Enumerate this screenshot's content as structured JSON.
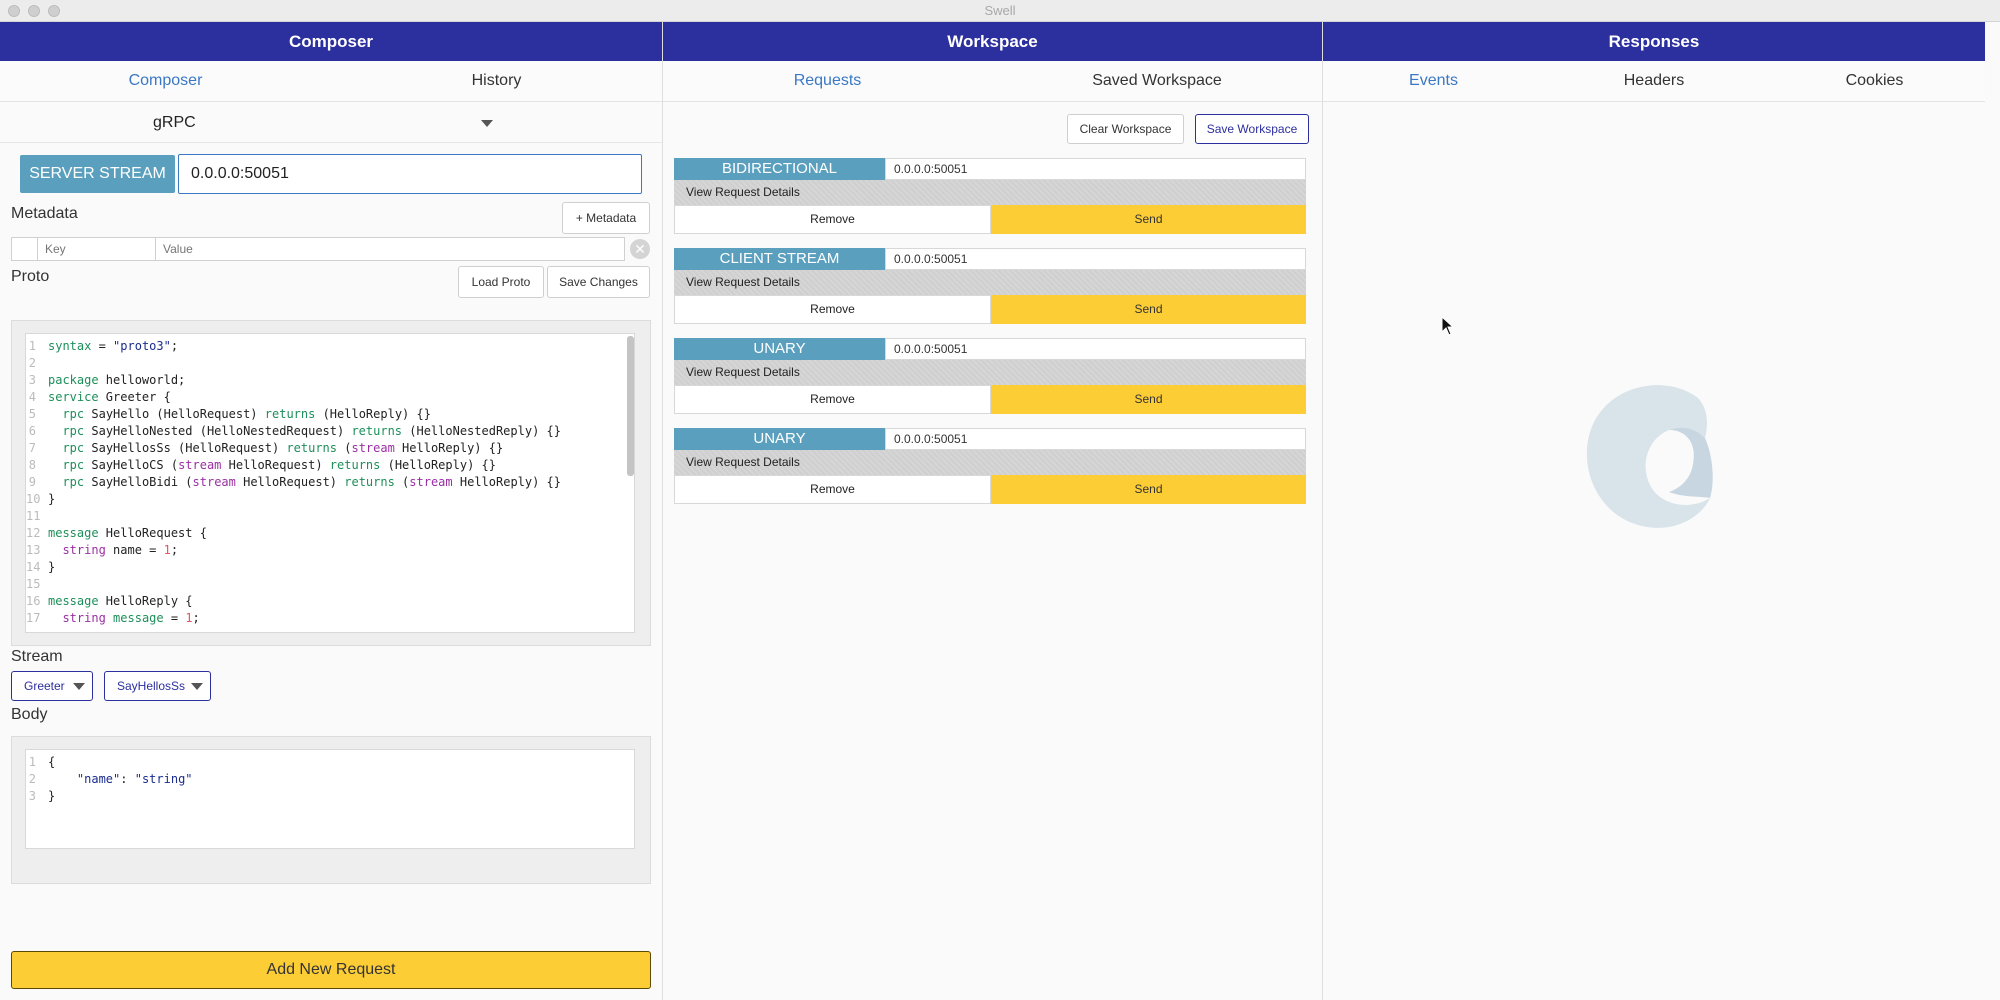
{
  "window": {
    "title": "Swell"
  },
  "composer": {
    "header": "Composer",
    "tabs": [
      {
        "label": "Composer"
      },
      {
        "label": "History"
      }
    ],
    "protocol": "gRPC",
    "method_label": "SERVER STREAM",
    "url_value": "0.0.0.0:50051",
    "metadata_label": "Metadata",
    "add_metadata_label": "+ Metadata",
    "key_placeholder": "Key",
    "value_placeholder": "Value",
    "proto_label": "Proto",
    "load_proto_label": "Load Proto",
    "save_changes_label": "Save Changes",
    "stream_label": "Stream",
    "service_select": "Greeter",
    "method_select": "SayHellosSs",
    "body_label": "Body",
    "add_request_label": "Add New Request"
  },
  "workspace": {
    "header": "Workspace",
    "tabs": [
      {
        "label": "Requests"
      },
      {
        "label": "Saved Workspace"
      }
    ],
    "clear_label": "Clear Workspace",
    "save_label": "Save Workspace",
    "requests": [
      {
        "type": "BIDIRECTIONAL",
        "url": "0.0.0.0:50051",
        "details": "View Request Details",
        "remove": "Remove",
        "send": "Send"
      },
      {
        "type": "CLIENT STREAM",
        "url": "0.0.0.0:50051",
        "details": "View Request Details",
        "remove": "Remove",
        "send": "Send"
      },
      {
        "type": "UNARY",
        "url": "0.0.0.0:50051",
        "details": "View Request Details",
        "remove": "Remove",
        "send": "Send"
      },
      {
        "type": "UNARY",
        "url": "0.0.0.0:50051",
        "details": "View Request Details",
        "remove": "Remove",
        "send": "Send"
      }
    ]
  },
  "responses": {
    "header": "Responses",
    "tabs": [
      {
        "label": "Events"
      },
      {
        "label": "Headers"
      },
      {
        "label": "Cookies"
      }
    ]
  },
  "proto_code": [
    "syntax = \"proto3\";",
    "",
    "package helloworld;",
    "service Greeter {",
    "  rpc SayHello (HelloRequest) returns (HelloReply) {}",
    "  rpc SayHelloNested (HelloNestedRequest) returns (HelloNestedReply) {}",
    "  rpc SayHellosSs (HelloRequest) returns (stream HelloReply) {}",
    "  rpc SayHelloCS (stream HelloRequest) returns (HelloReply) {}",
    "  rpc SayHelloBidi (stream HelloRequest) returns (stream HelloReply) {}",
    "}",
    "",
    "message HelloRequest {",
    "  string name = 1;",
    "}",
    "",
    "message HelloReply {",
    "  string message = 1;"
  ],
  "body_code": [
    "{",
    "    \"name\": \"string\"",
    "}"
  ],
  "colors": {
    "header": "#2c2f9e",
    "accent_blue": "#3b78c4",
    "method_badge": "#5a9fbd",
    "send_yellow": "#fdcd35"
  }
}
